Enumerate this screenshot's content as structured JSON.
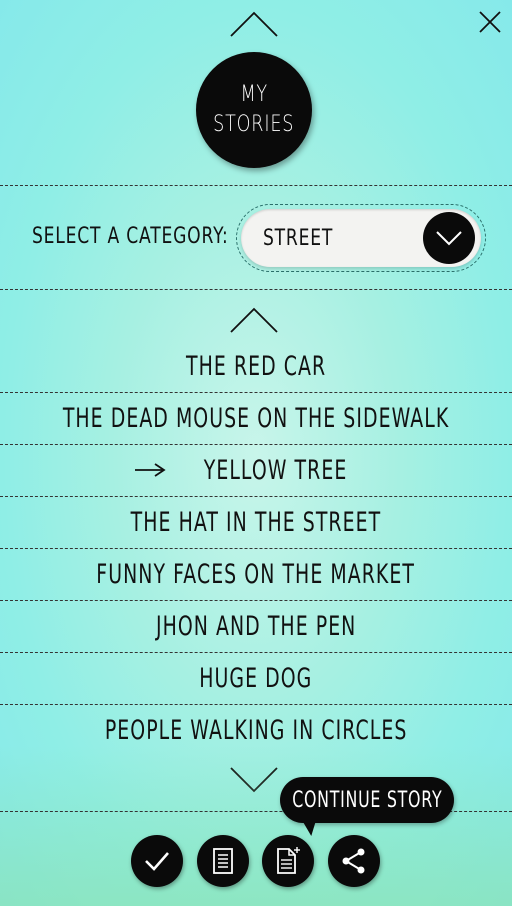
{
  "header": {
    "title_line1": "MY",
    "title_line2": "STORIES"
  },
  "icons": {
    "close": "close-icon",
    "chevron_up": "chevron-up-icon",
    "chevron_down": "chevron-down-icon",
    "arrow": "arrow-right-icon",
    "toolbar": [
      "check-icon",
      "document-icon",
      "new-document-icon",
      "share-icon"
    ]
  },
  "category": {
    "label": "SELECT A CATEGORY:",
    "selected": "STREET"
  },
  "stories": {
    "items": [
      "THE RED CAR",
      "THE DEAD MOUSE ON THE SIDEWALK",
      "YELLOW TREE",
      "THE HAT IN THE STREET",
      "FUNNY FACES ON THE MARKET",
      "JHON AND THE PEN",
      "HUGE DOG",
      "PEOPLE WALKING IN CIRCLES"
    ],
    "selected_index": 2
  },
  "toolbar": {
    "tooltip": "CONTINUE STORY"
  },
  "colors": {
    "background_top": "#86e9ea",
    "background_bottom": "#a6ecc4",
    "accent": "#0a0a0a",
    "pill": "#f3f3f1"
  }
}
